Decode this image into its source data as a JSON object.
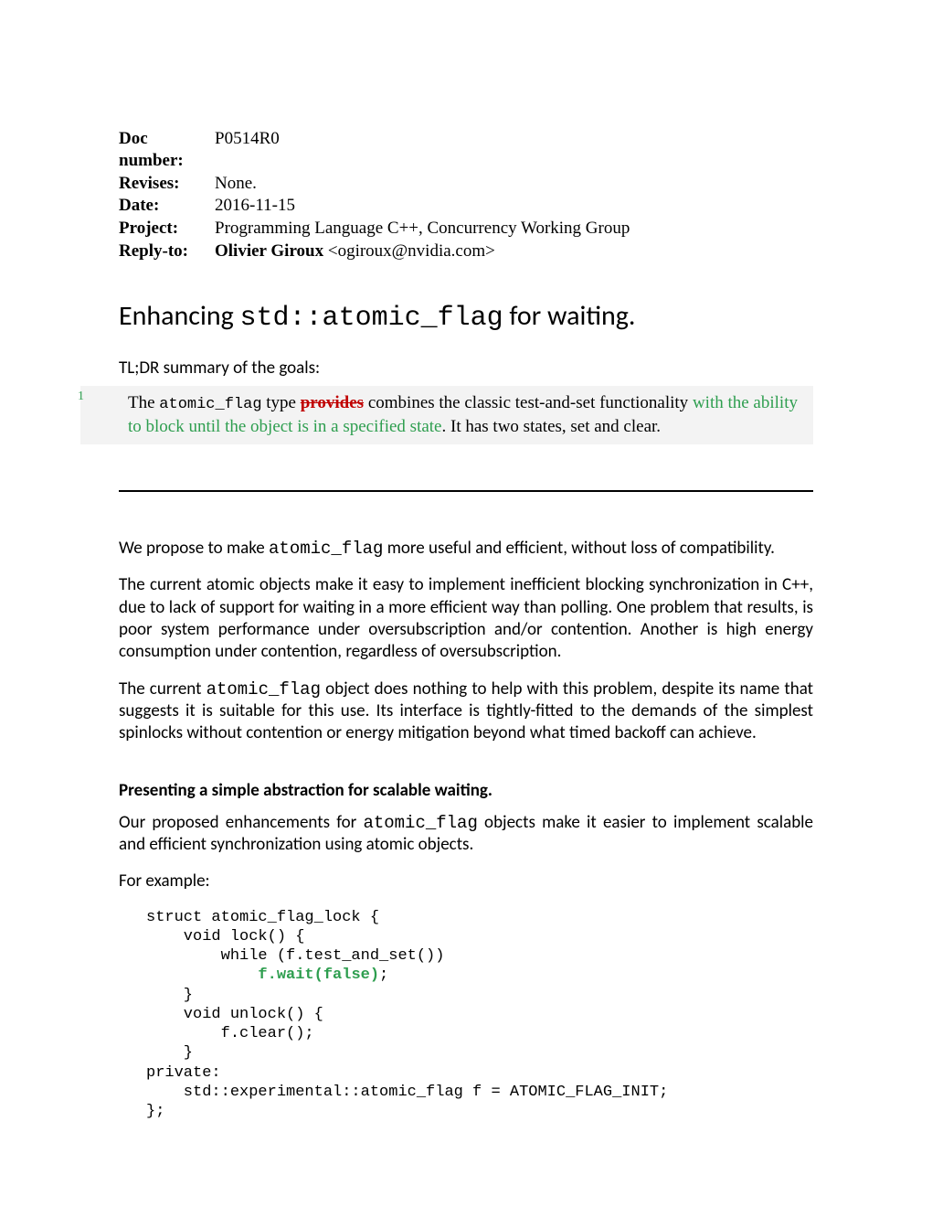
{
  "meta": {
    "doc_number_label": "Doc number:",
    "doc_number": "P0514R0",
    "revises_label": "Revises:",
    "revises": "None.",
    "date_label": "Date:",
    "date": "2016-11-15",
    "project_label": "Project:",
    "project": "Programming Language C++, Concurrency Working Group",
    "reply_label": "Reply-to:",
    "reply_name": "Olivier Giroux ",
    "reply_email": "<ogiroux@nvidia.com>"
  },
  "title": {
    "pre": "Enhancing ",
    "code": "std::atomic_flag",
    "post": " for waiting."
  },
  "tldr_label": "TL;DR summary of the goals:",
  "summary": {
    "num": "1",
    "text_a": "The ",
    "code_a": "atomic_flag",
    "text_b": " type ",
    "deleted": "provides",
    "text_c": " combines",
    "text_d": " the classic test-and-set functionality ",
    "added": "with the ability to block until the object is in a specified state",
    "text_e": ". It has two states, set and clear."
  },
  "p1a": "We propose to make ",
  "p1code": "atomic_flag",
  "p1b": " more useful and efficient, without loss of compatibility.",
  "p2": "The current atomic objects make it easy to implement inefficient blocking synchronization in C++, due to lack of support for waiting in a more efficient way than polling. One problem that results, is poor system performance under oversubscription and/or contention.  Another is high energy consumption under contention, regardless of oversubscription.",
  "p3a": "The current ",
  "p3code": "atomic_flag",
  "p3b": " object does nothing to help with this problem, despite its name that suggests it is suitable for this use. Its interface is tightly-fitted to the demands of the simplest spinlocks without contention or energy mitigation beyond what timed backoff can achieve.",
  "section_head": "Presenting a simple abstraction for scalable waiting.",
  "p4a": "Our proposed enhancements for ",
  "p4code": "atomic_flag",
  "p4b": " objects make it easier to implement scalable and efficient synchronization using atomic objects.",
  "p5": "For example:",
  "code": {
    "l1": "struct atomic_flag_lock {",
    "l2": "    void lock() {",
    "l3": "        while (f.test_and_set())",
    "l4a": "            ",
    "l4b": "f.wait(false)",
    "l4c": ";",
    "l5": "    }",
    "l6": "    void unlock() {",
    "l7": "        f.clear();",
    "l8": "    }",
    "l9": "private:",
    "l10": "    std::experimental::atomic_flag f = ATOMIC_FLAG_INIT;",
    "l11": "};"
  }
}
